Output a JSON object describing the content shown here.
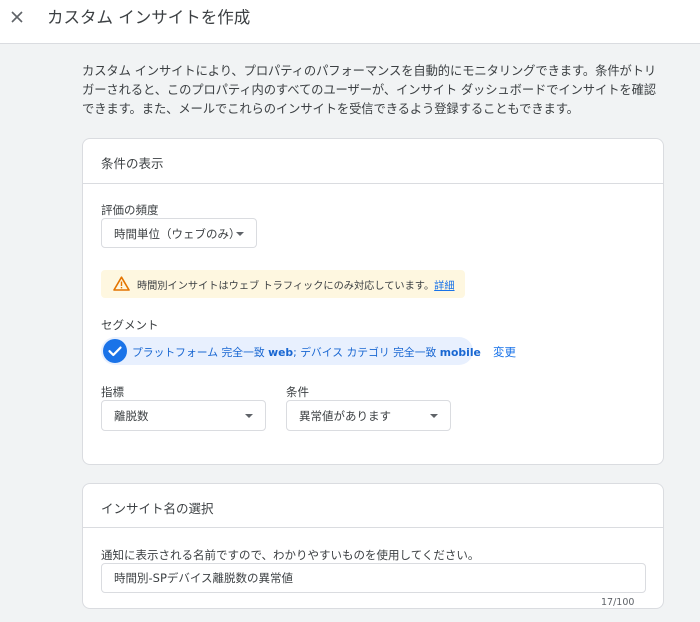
{
  "header": {
    "close_icon": "close-icon",
    "title": "カスタム インサイトを作成"
  },
  "intro": {
    "text": "カスタム インサイトにより、プロパティのパフォーマンスを自動的にモニタリングできます。条件がトリガーされると、このプロパティ内のすべてのユーザーが、インサイト ダッシュボードでインサイトを確認できます。また、メールでこれらのインサイトを受信できるよう登録することもできます。"
  },
  "conditions_card": {
    "title": "条件の表示",
    "frequency": {
      "label": "評価の頻度",
      "value": "時間単位（ウェブのみ）"
    },
    "warning": {
      "icon": "warning-icon",
      "text": "時間別インサイトはウェブ トラフィックにのみ対応しています。",
      "link": "詳細"
    },
    "segment": {
      "label": "セグメント",
      "chip_part1": "プラットフォーム 完全一致 ",
      "chip_value1": "web",
      "chip_part2": "; デバイス カテゴリ 完全一致 ",
      "chip_value2": "mobile",
      "change_link": "変更"
    },
    "metric": {
      "label": "指標",
      "value": "離脱数"
    },
    "condition": {
      "label": "条件",
      "value": "異常値があります"
    }
  },
  "name_card": {
    "title": "インサイト名の選択",
    "hint": "通知に表示される名前ですので、わかりやすいものを使用してください。",
    "name_value": "時間別-SPデバイス離脱数の異常値",
    "counter": "17/100"
  },
  "colors": {
    "accent": "#1a73e8",
    "chip_bg": "#e8f0fe",
    "warning_bg": "#fef7e0",
    "warning_icon": "#e37400",
    "page_bg": "#f1f3f4"
  }
}
